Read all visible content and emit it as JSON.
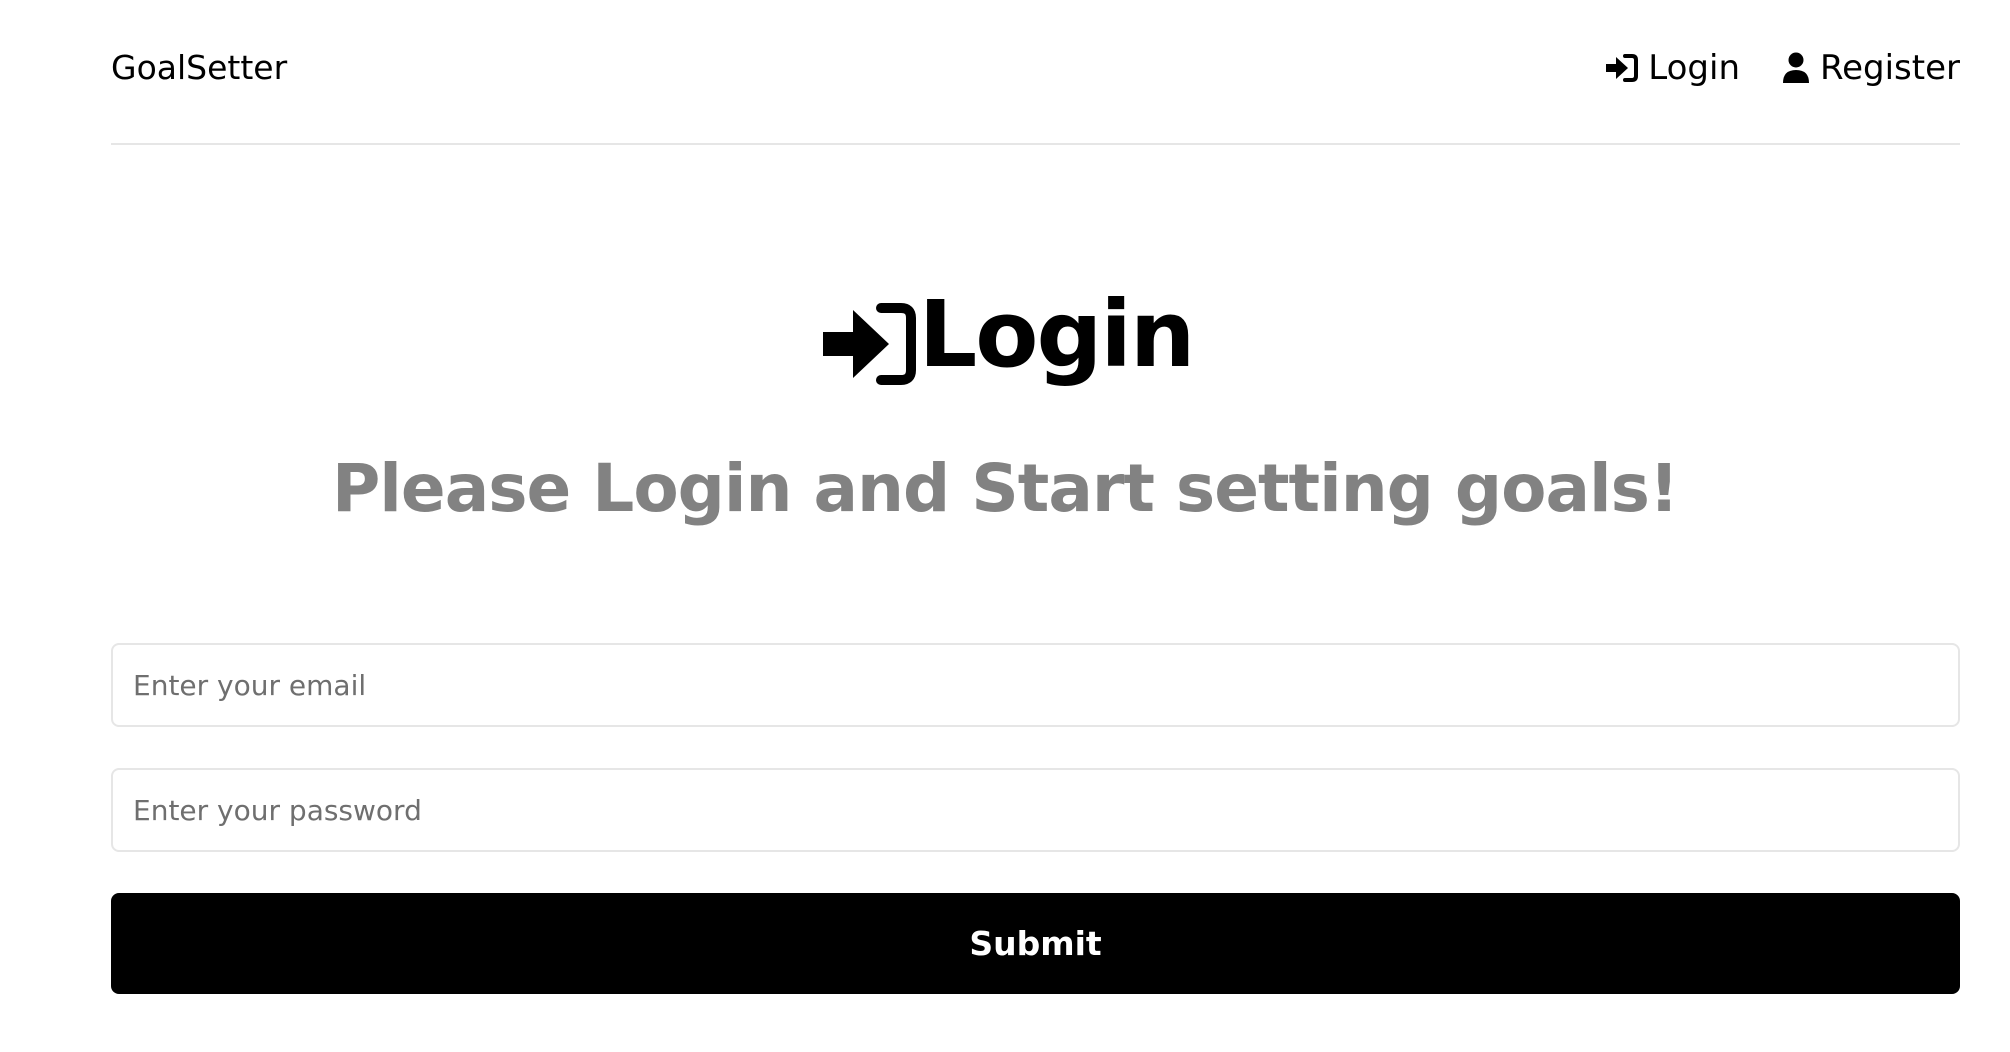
{
  "header": {
    "brand": "GoalSetter",
    "nav": {
      "login_label": "Login",
      "login_icon": "sign-in-icon",
      "register_label": "Register",
      "register_icon": "user-icon"
    }
  },
  "main": {
    "heading": "Login",
    "heading_icon": "sign-in-icon",
    "subheading": "Please Login and Start setting goals!"
  },
  "form": {
    "email_placeholder": "Enter your email",
    "email_value": "",
    "password_placeholder": "Enter your password",
    "password_value": "",
    "submit_label": "Submit"
  }
}
